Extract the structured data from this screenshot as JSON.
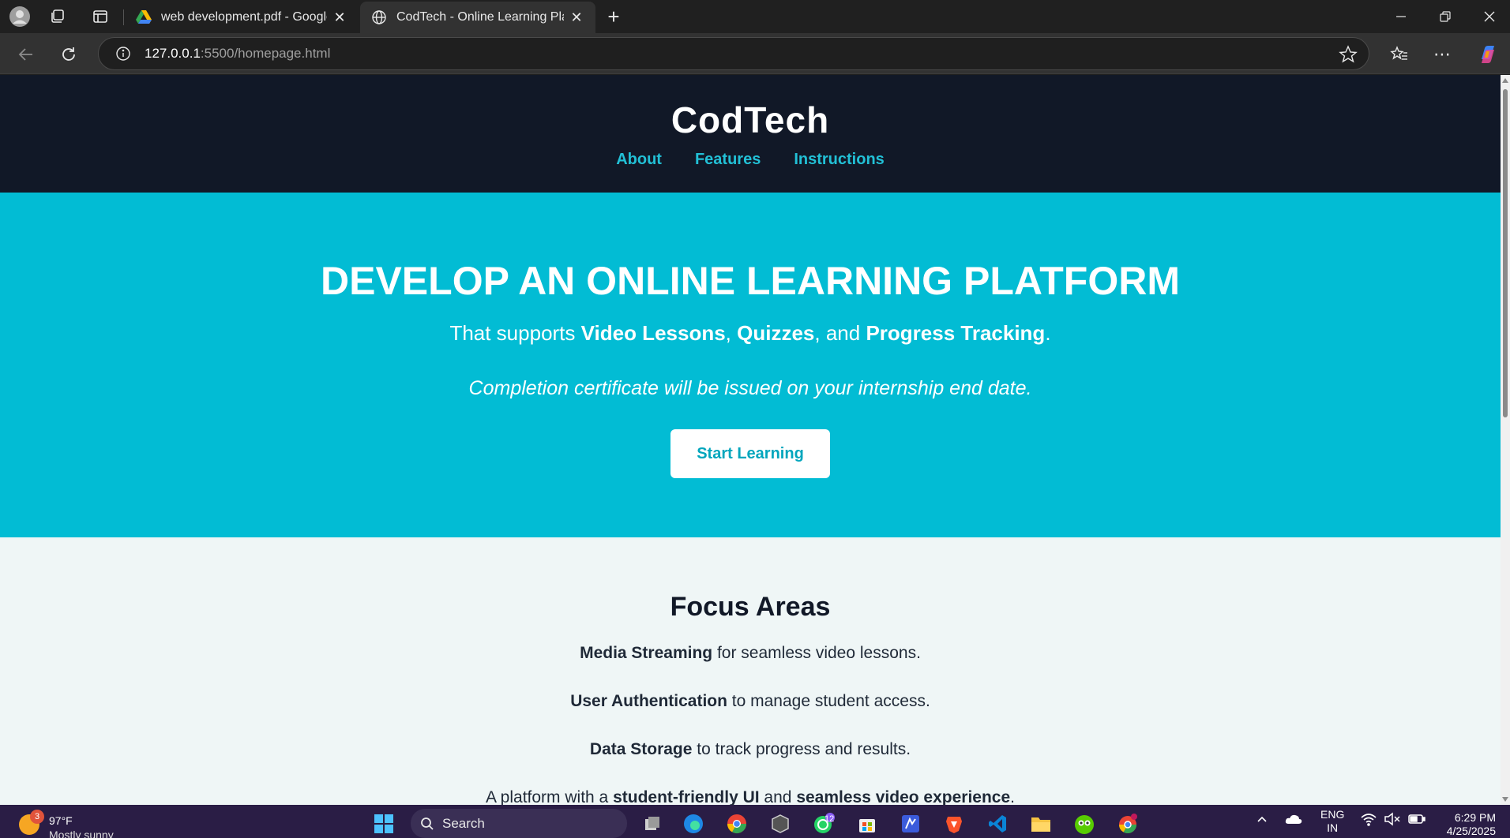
{
  "browser": {
    "tabs": [
      {
        "title": "web development.pdf - Google D",
        "active": false
      },
      {
        "title": "CodTech - Online Learning Platfor",
        "active": true
      }
    ],
    "url_host": "127.0.0.1",
    "url_rest": ":5500/homepage.html"
  },
  "site": {
    "brand": "CodTech",
    "nav": [
      {
        "label": "About"
      },
      {
        "label": "Features"
      },
      {
        "label": "Instructions"
      }
    ]
  },
  "hero": {
    "title": "DEVELOP AN ONLINE LEARNING PLATFORM",
    "sub_prefix": "That supports ",
    "sub_item1": "Video Lessons",
    "sub_sep1": ", ",
    "sub_item2": "Quizzes",
    "sub_sep2": ", and ",
    "sub_item3": "Progress Tracking",
    "sub_end": ".",
    "note": "Completion certificate will be issued on your internship end date.",
    "cta_label": "Start Learning"
  },
  "focus": {
    "heading": "Focus Areas",
    "items": [
      {
        "strong": "Media Streaming",
        "text": " for seamless video lessons."
      },
      {
        "strong": "User Authentication",
        "text": " to manage student access."
      },
      {
        "strong": "Data Storage",
        "text": " to track progress and results."
      }
    ],
    "last_prefix": "A platform with a ",
    "last_strong1": "student-friendly UI",
    "last_mid": " and ",
    "last_strong2": "seamless video experience",
    "last_end": "."
  },
  "taskbar": {
    "weather_badge": "3",
    "weather_temp": "97°F",
    "weather_desc": "Mostly sunny",
    "search_label": "Search",
    "whatsapp_badge": "12",
    "lang_line1": "ENG",
    "lang_line2": "IN",
    "time": "6:29 PM",
    "date": "4/25/2025"
  },
  "colors": {
    "header_bg": "#111827",
    "nav_link": "#22c0d6",
    "hero_bg": "#02bcd4",
    "body_bg": "#eff6f6",
    "cta_text": "#02a6bd"
  }
}
